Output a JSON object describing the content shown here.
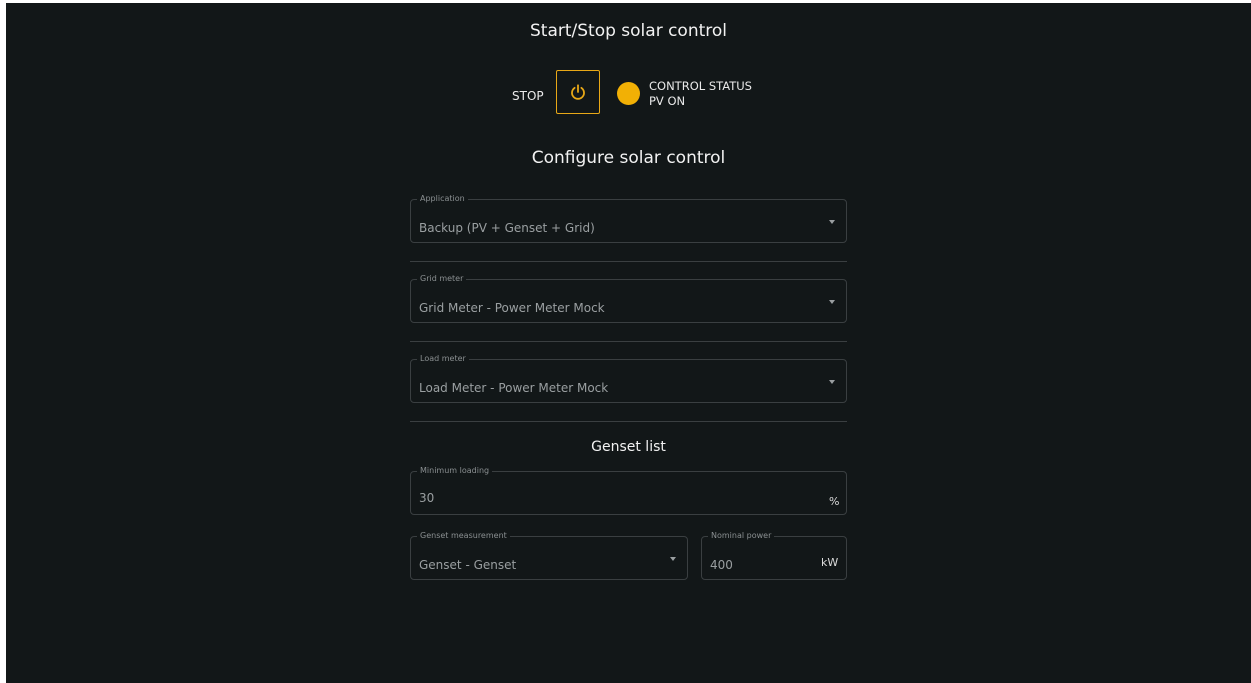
{
  "header": {
    "title": "Start/Stop solar control"
  },
  "control": {
    "stop_label": "STOP",
    "status_title": "CONTROL STATUS",
    "status_value": "PV ON",
    "status_color": "#f2b005",
    "accent_color": "#e8a817",
    "power_icon": "power-icon"
  },
  "configure": {
    "title": "Configure solar control",
    "application": {
      "label": "Application",
      "value": "Backup (PV + Genset + Grid)"
    },
    "grid_meter": {
      "label": "Grid meter",
      "value": "Grid Meter - Power Meter Mock"
    },
    "load_meter": {
      "label": "Load meter",
      "value": "Load Meter - Power Meter Mock"
    }
  },
  "genset": {
    "title": "Genset list",
    "minimum_loading": {
      "label": "Minimum loading",
      "value": "30",
      "unit": "%"
    },
    "measurement": {
      "label": "Genset measurement",
      "value": "Genset - Genset"
    },
    "nominal_power": {
      "label": "Nominal power",
      "value": "400",
      "unit": "kW"
    }
  }
}
